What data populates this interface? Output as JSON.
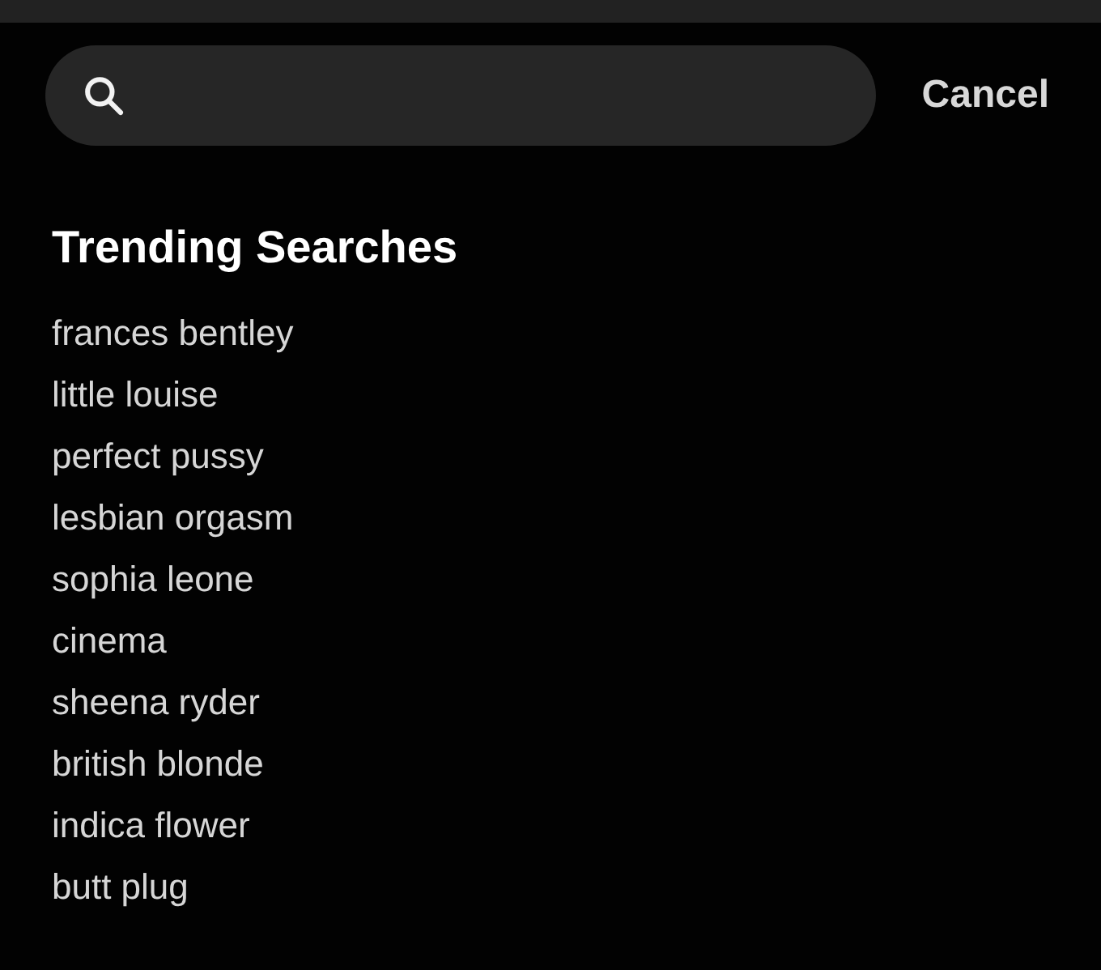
{
  "search": {
    "cancel": "Cancel"
  },
  "trending": {
    "title": "Trending Searches",
    "items": [
      "frances bentley",
      "little louise",
      "perfect pussy",
      "lesbian orgasm",
      "sophia leone",
      "cinema",
      "sheena ryder",
      "british blonde",
      "indica flower",
      "butt plug"
    ]
  }
}
